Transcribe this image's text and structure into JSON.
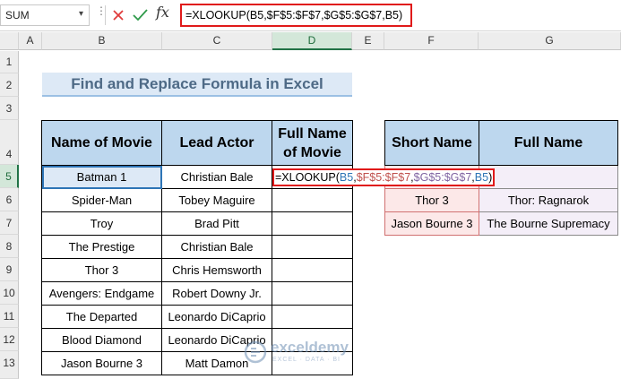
{
  "formula_bar": {
    "name_box": "SUM",
    "fx_label": "fx",
    "formula": "=XLOOKUP(B5,$F$5:$F$7,$G$5:$G$7,B5)"
  },
  "columns": [
    "A",
    "B",
    "C",
    "D",
    "E",
    "F",
    "G"
  ],
  "rows": [
    "1",
    "2",
    "3",
    "4",
    "5",
    "6",
    "7",
    "8",
    "9",
    "10",
    "11",
    "12",
    "13"
  ],
  "title": "Find and Replace Formula in Excel",
  "main_table": {
    "headers": [
      "Name of Movie",
      "Lead Actor",
      "Full Name of Movie"
    ],
    "rows": [
      [
        "Batman 1",
        "Christian Bale"
      ],
      [
        "Spider-Man",
        "Tobey Maguire"
      ],
      [
        "Troy",
        "Brad Pitt"
      ],
      [
        "The Prestige",
        "Christian Bale"
      ],
      [
        "Thor 3",
        "Chris Hemsworth"
      ],
      [
        "Avengers: Endgame",
        "Robert Downy Jr."
      ],
      [
        "The Departed",
        "Leonardo DiCaprio"
      ],
      [
        "Blood Diamond",
        "Leonardo DiCaprio"
      ],
      [
        "Jason Bourne 3",
        "Matt Damon"
      ]
    ],
    "formula_parts": {
      "p1": "=XLOOKUP(",
      "p2": "B5",
      "p3": ",",
      "p4": "$F$5:$F$7",
      "p5": ",",
      "p6": "$G$5:$G$7",
      "p7": ",",
      "p8": "B5",
      "p9": ")"
    }
  },
  "lookup_table": {
    "headers": [
      "Short Name",
      "Full Name"
    ],
    "rows": [
      [
        "",
        ""
      ],
      [
        "Thor 3",
        "Thor: Ragnarok"
      ],
      [
        "Jason Bourne 3",
        "The Bourne Supremacy"
      ]
    ]
  },
  "watermark": {
    "name": "exceldemy",
    "tagline": "EXCEL · DATA · BI"
  },
  "colors": {
    "accent_green": "#217346",
    "header_fill": "#bdd7ee",
    "title_fill": "#dde9f6",
    "formula_highlight": "#e01a1a",
    "ref_blue": "#2e75b6",
    "ref_red": "#c0504d",
    "ref_purple": "#8064a2"
  }
}
